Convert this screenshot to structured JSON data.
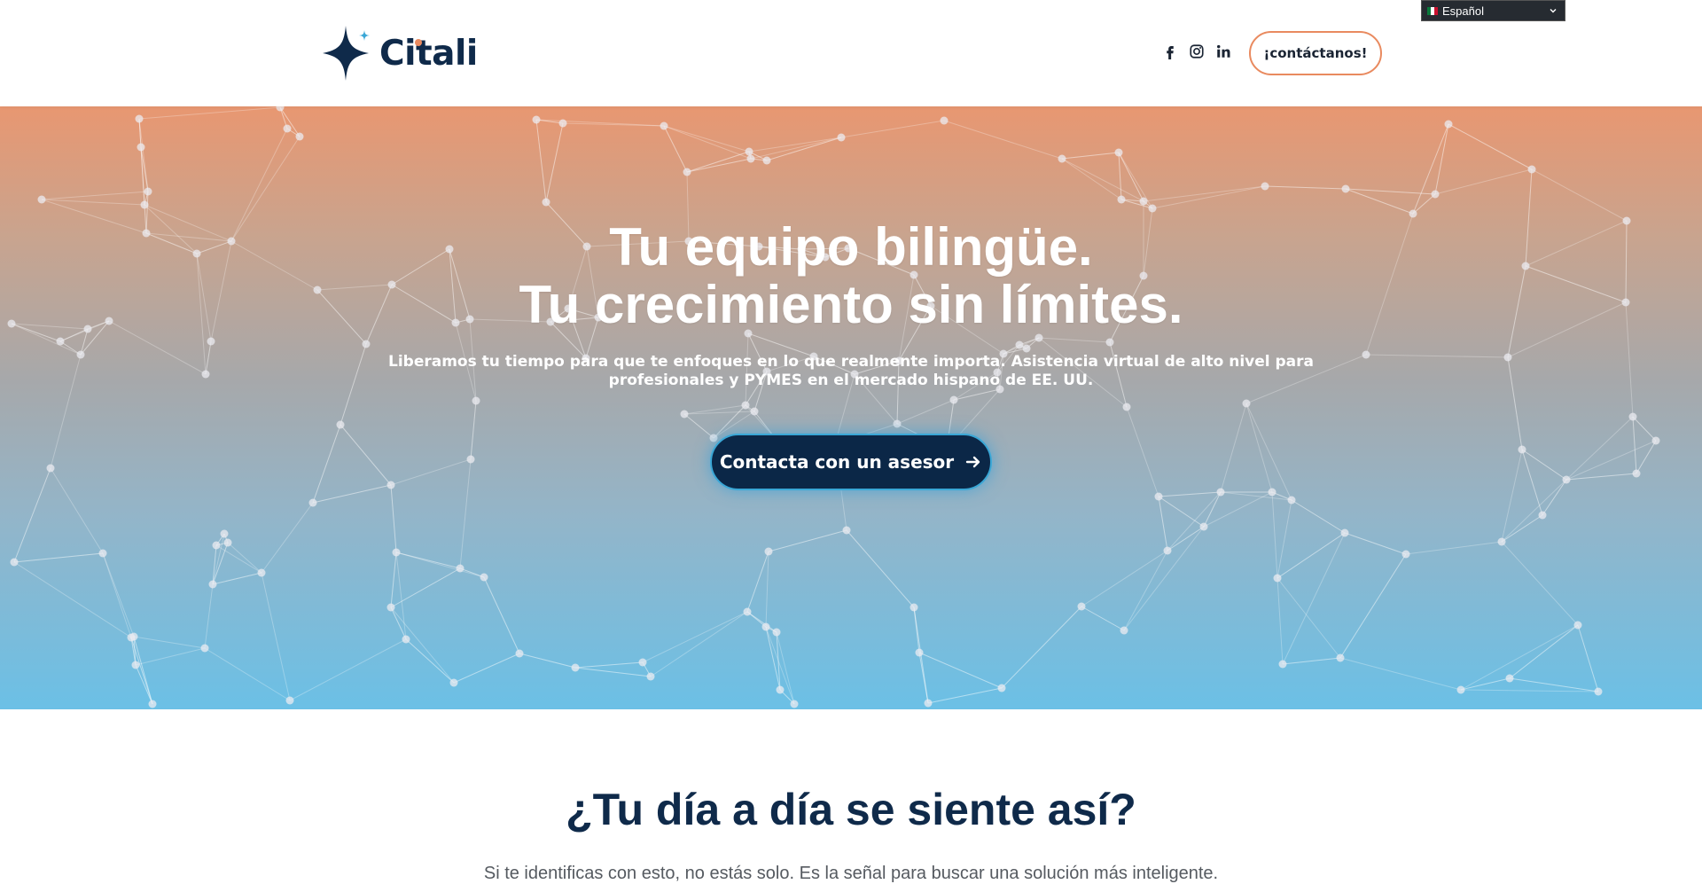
{
  "header": {
    "logo_text": "Citali",
    "social_icons": [
      "facebook-icon",
      "instagram-icon",
      "linkedin-icon"
    ],
    "contact_label": "¡contáctanos!"
  },
  "language": {
    "selected": "Español",
    "flag": "mexico-flag-icon"
  },
  "hero": {
    "title_line1": "Tu equipo bilingüe.",
    "title_line2": "Tu crecimiento sin límites.",
    "subtitle": "Liberamos tu tiempo para que te enfoques en lo que realmente importa. Asistencia virtual de alto nivel para profesionales y PYMES en el mercado hispano de EE. UU.",
    "cta_label": "Contacta con un asesor"
  },
  "section": {
    "title": "¿Tu día a día se siente así?",
    "subtitle": "Si te identificas con esto, no estás solo. Es la señal para buscar una solución más inteligente."
  },
  "colors": {
    "brand_navy": "#0f2a4a",
    "accent_orange": "#e98a5f",
    "accent_blue": "#3aa7d6",
    "hero_top": "#e89771",
    "hero_bottom": "#6bc0e6"
  }
}
